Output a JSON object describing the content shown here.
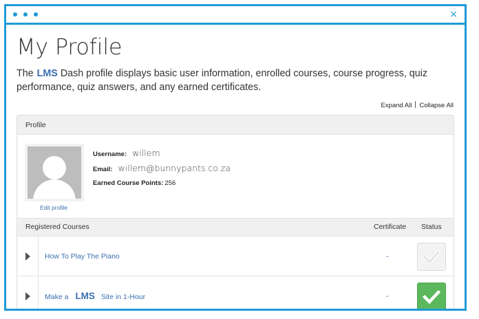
{
  "window": {
    "accent": "#1f9ad6",
    "close_icon": "×"
  },
  "page": {
    "title": "My Profile",
    "intro_prefix": "The",
    "intro_brand": "LMS",
    "intro_rest": "Dash profile displays basic user information, enrolled courses, course progress, quiz performance, quiz answers, and any earned certificates."
  },
  "controls": {
    "expand_all": "Expand All",
    "collapse_all": "Collapse All"
  },
  "profile": {
    "header": "Profile",
    "edit_profile": "Edit profile",
    "username_label": "Username:",
    "username": "willem",
    "email_label": "Email:",
    "email": "willem@bunnypants.co.za",
    "points_label": "Earned Course Points:",
    "points": "256"
  },
  "courses": {
    "header": "Registered Courses",
    "certificate_header": "Certificate",
    "status_header": "Status",
    "items": [
      {
        "title_pre": "How To Play The Piano",
        "title_brand": "",
        "title_post": "",
        "certificate": "-",
        "status": "incomplete"
      },
      {
        "title_pre": "Make a",
        "title_brand": "LMS",
        "title_post": "Site in 1-Hour",
        "certificate": "-",
        "status": "complete"
      }
    ]
  },
  "colors": {
    "link": "#3c6fb0",
    "complete_green": "#5cb85c",
    "incomplete_gray": "#f3f3f3"
  }
}
